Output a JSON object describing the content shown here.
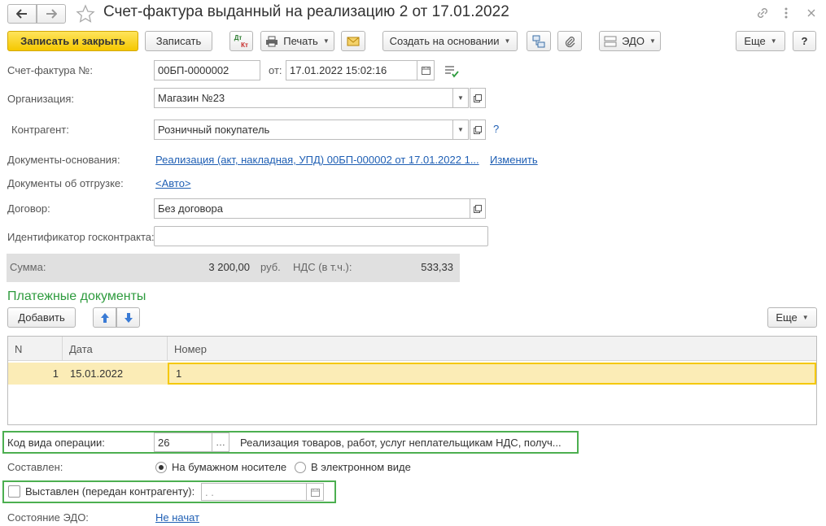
{
  "title": "Счет-фактура выданный на реализацию 2 от 17.01.2022",
  "icons": {
    "back": "arrow-left-icon",
    "forward": "arrow-right-icon",
    "favorite": "star-icon",
    "link": "link-icon",
    "more": "kebab-icon",
    "close": "close-icon"
  },
  "toolbar": {
    "save_close": "Записать и закрыть",
    "save": "Записать",
    "dtkt_top": "Дт",
    "dtkt_bottom": "Кт",
    "print": "Печать",
    "create_based": "Создать на основании",
    "edo": "ЭДО",
    "more": "Еще",
    "help": "?"
  },
  "form": {
    "invoice_no_label": "Счет-фактура №:",
    "invoice_no": "00БП-0000002",
    "date_label": "от:",
    "date": "17.01.2022 15:02:16",
    "org_label": "Организация:",
    "org": "Магазин №23",
    "counterparty_label": "Контрагент:",
    "counterparty": "Розничный покупатель",
    "help_mark": "?",
    "base_docs_label": "Документы-основания:",
    "base_docs_link": "Реализация (акт, накладная, УПД) 00БП-000002 от 17.01.2022 1...",
    "change_link": "Изменить",
    "ship_docs_label": "Документы об отгрузке:",
    "ship_docs_link": "<Авто>",
    "contract_label": "Договор:",
    "contract": "Без договора",
    "gov_contract_label": "Идентификатор госконтракта:",
    "gov_contract": "",
    "sum_label": "Сумма:",
    "sum": "3 200,00",
    "currency": "руб.",
    "vat_label": "НДС (в т.ч.):",
    "vat": "533,33"
  },
  "payments": {
    "section_title": "Платежные документы",
    "add": "Добавить",
    "more": "Еще",
    "columns": [
      "N",
      "Дата",
      "Номер"
    ],
    "rows": [
      {
        "n": "1",
        "date": "15.01.2022",
        "number": "1"
      }
    ]
  },
  "bottom": {
    "op_code_label": "Код вида операции:",
    "op_code": "26",
    "op_code_desc": "Реализация товаров, работ, услуг неплательщикам НДС, получ...",
    "composed_label": "Составлен:",
    "paper": "На бумажном носителе",
    "electronic": "В электронном виде",
    "issued_label": "Выставлен (передан контрагенту):",
    "issued_date": " .  .",
    "edo_state_label": "Состояние ЭДО:",
    "edo_state": "Не начат"
  },
  "colors": {
    "accent_green": "#4caf50",
    "section_title": "#2e9b3e",
    "link": "#1f5fb4",
    "selected_row": "#fbecb6"
  }
}
